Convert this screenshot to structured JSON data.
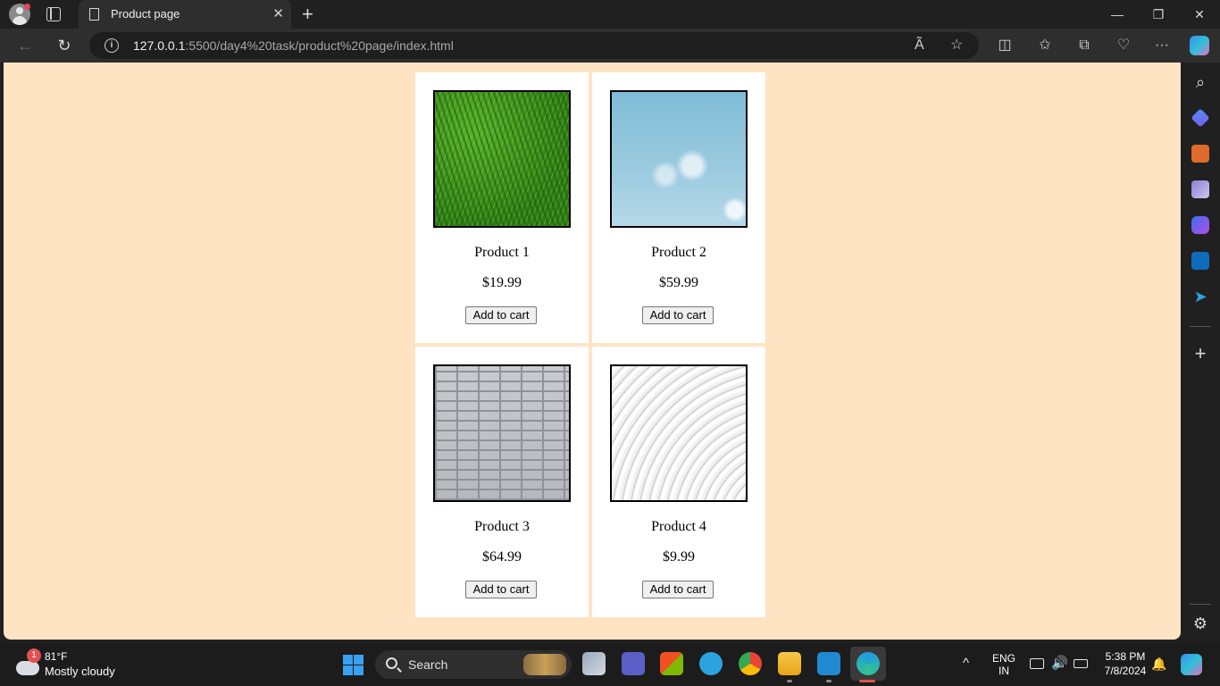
{
  "browser": {
    "tab": {
      "title": "Product page",
      "close": "✕"
    },
    "new_tab": "+",
    "window": {
      "minimize": "—",
      "maximize": "❐",
      "close": "✕"
    },
    "nav": {
      "back": "←",
      "refresh": "↻"
    },
    "url": {
      "host": "127.0.0.1",
      "rest": ":5500/day4%20task/product%20page/index.html",
      "info": "i"
    },
    "url_icons": {
      "read_aloud": "Ã",
      "favorite": "☆"
    },
    "toolbar": {
      "split": "◫",
      "favorites": "✩",
      "collections": "⧉",
      "health": "♡",
      "more": "···"
    }
  },
  "page": {
    "products": [
      {
        "name": "Product 1",
        "price": "$19.99",
        "button": "Add to cart",
        "image": "grass"
      },
      {
        "name": "Product 2",
        "price": "$59.99",
        "button": "Add to cart",
        "image": "sky"
      },
      {
        "name": "Product 3",
        "price": "$64.99",
        "button": "Add to cart",
        "image": "brick"
      },
      {
        "name": "Product 4",
        "price": "$9.99",
        "button": "Add to cart",
        "image": "waves"
      }
    ]
  },
  "sidebar": {
    "icons": [
      "search-icon",
      "tag-icon",
      "tools-icon",
      "games-icon",
      "copilot-icon",
      "outlook-icon",
      "telegram-icon"
    ],
    "add": "+",
    "settings": "⚙"
  },
  "taskbar": {
    "weather": {
      "badge": "1",
      "temp": "81°F",
      "desc": "Mostly cloudy"
    },
    "search": {
      "label": "Search"
    },
    "apps": [
      "file-explorer-multi",
      "teams",
      "store",
      "telegram",
      "chrome",
      "file-explorer",
      "vscode",
      "edge"
    ],
    "tray": {
      "chevron": "^",
      "lang1": "ENG",
      "lang2": "IN",
      "time": "5:38 PM",
      "date": "7/8/2024",
      "bell": "🔔"
    }
  },
  "colors": {
    "page_bg": "#ffe4c4",
    "card_bg": "#ffffff",
    "chrome_dark": "#202020",
    "accent_blue": "#3aa0f2"
  }
}
